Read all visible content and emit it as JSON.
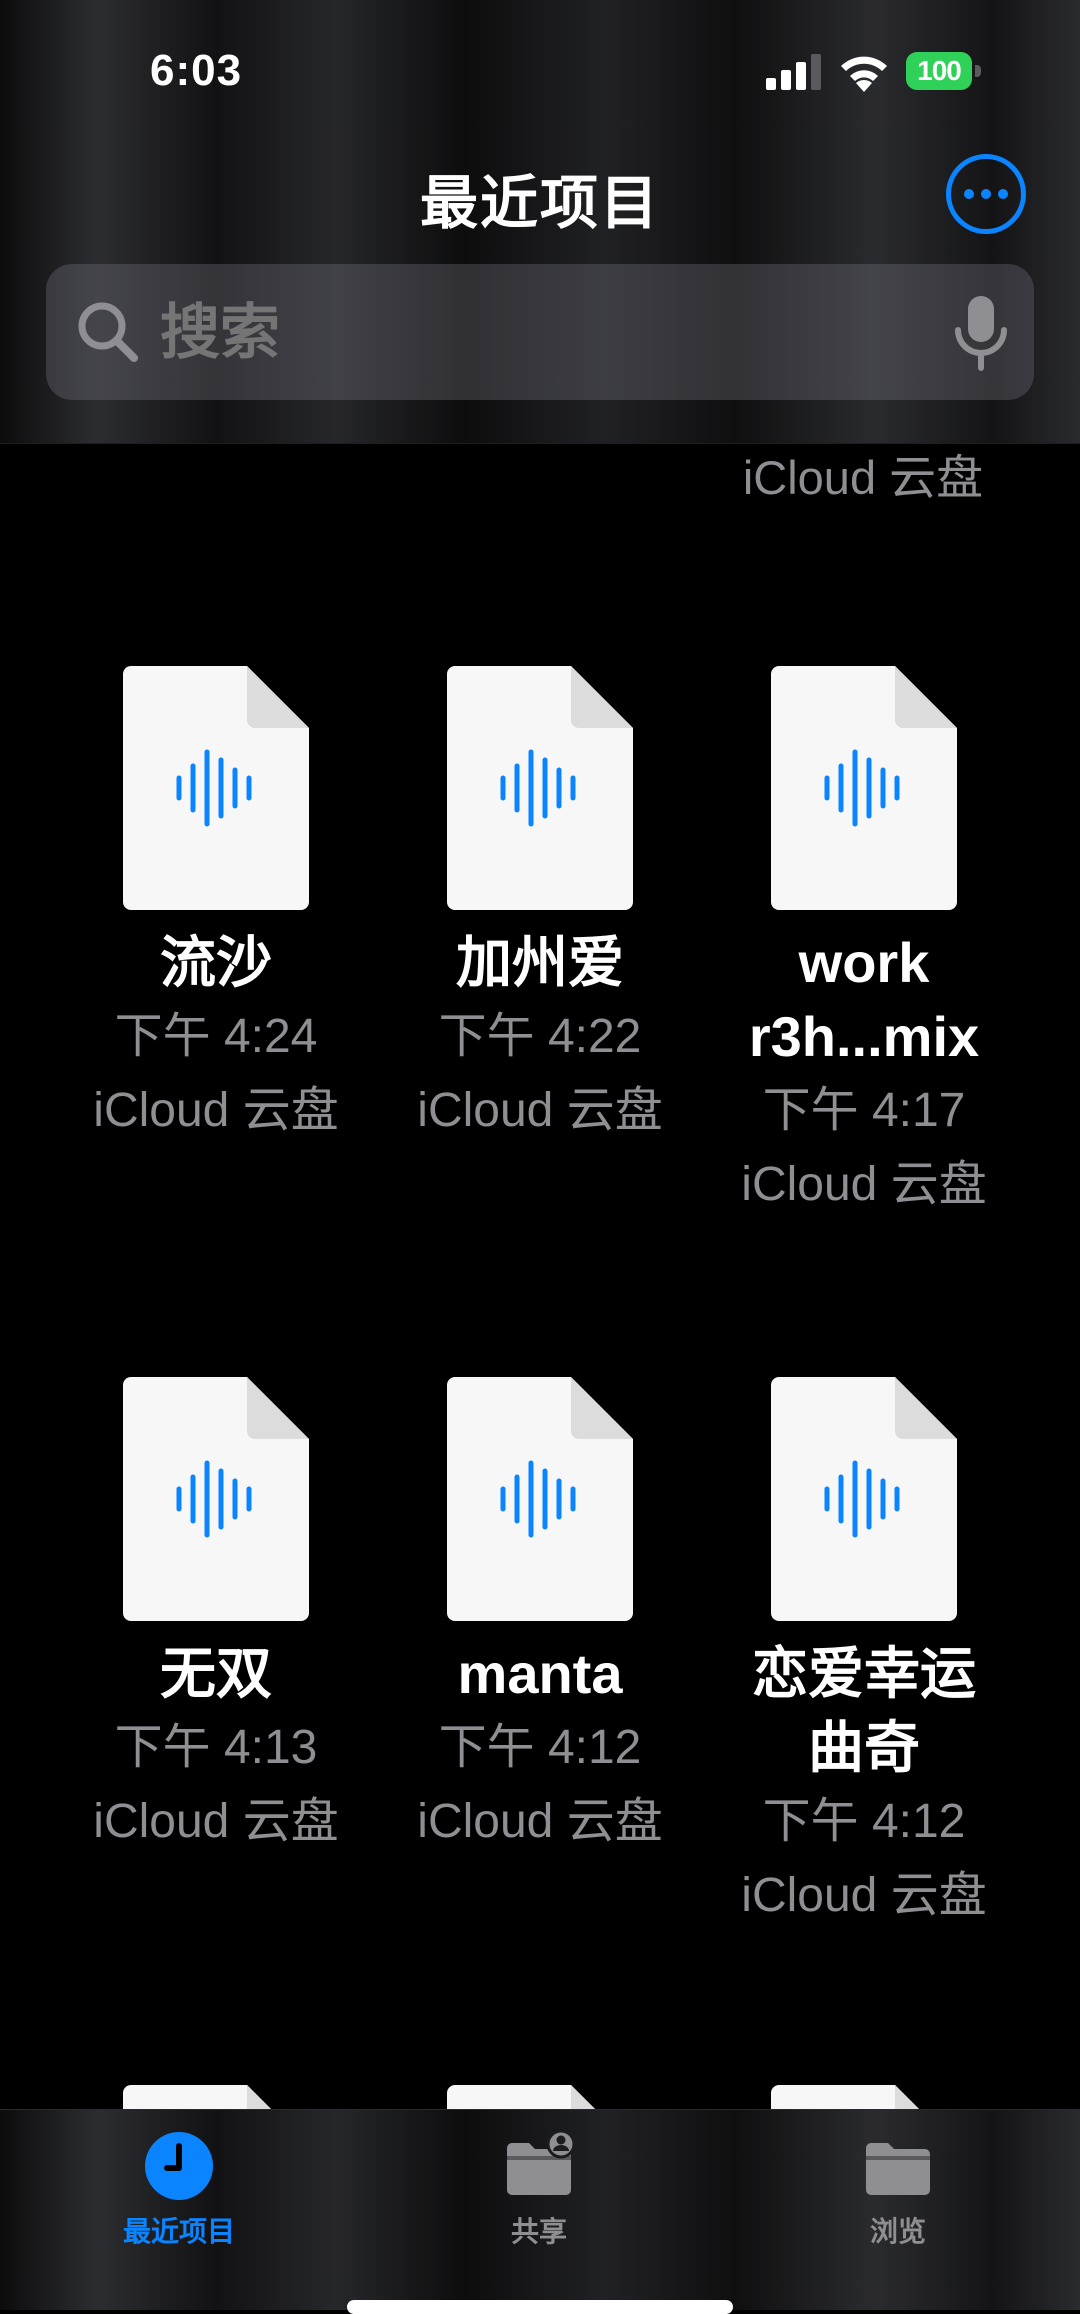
{
  "status_bar": {
    "time": "6:03",
    "battery": "100"
  },
  "nav": {
    "title": "最近项目"
  },
  "search": {
    "placeholder": "搜索"
  },
  "top_partial": {
    "location": "iCloud 云盘"
  },
  "files": [
    {
      "name": "流沙",
      "time": "下午 4:24",
      "location": "iCloud 云盘"
    },
    {
      "name": "加州爱",
      "time": "下午 4:22",
      "location": "iCloud 云盘"
    },
    {
      "name": "work r3h...mix",
      "time": "下午 4:17",
      "location": "iCloud 云盘"
    },
    {
      "name": "无双",
      "time": "下午 4:13",
      "location": "iCloud 云盘"
    },
    {
      "name": "manta",
      "time": "下午 4:12",
      "location": "iCloud 云盘"
    },
    {
      "name": "恋爱幸运曲奇",
      "time": "下午 4:12",
      "location": "iCloud 云盘"
    }
  ],
  "tabs": [
    {
      "label": "最近项目",
      "icon": "clock-icon",
      "active": true
    },
    {
      "label": "共享",
      "icon": "shared-folder-icon",
      "active": false
    },
    {
      "label": "浏览",
      "icon": "folder-icon",
      "active": false
    }
  ],
  "colors": {
    "accent": "#0a84ff",
    "secondary_text": "#8e8e93",
    "battery": "#30d158",
    "background": "#000000"
  }
}
